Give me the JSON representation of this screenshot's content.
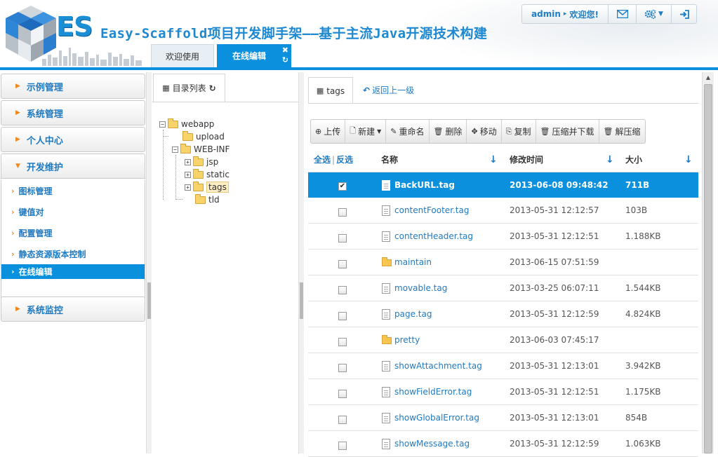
{
  "header": {
    "logo_text": "ES",
    "title": "Easy-Scaffold项目开发脚手架——基于主流Java开源技术构建",
    "user": "admin",
    "welcome": "欢迎您!",
    "tabs": [
      {
        "label": "欢迎使用"
      },
      {
        "label": "在线编辑"
      }
    ]
  },
  "sidebar": {
    "sections": [
      {
        "label": "示例管理"
      },
      {
        "label": "系统管理"
      },
      {
        "label": "个人中心"
      },
      {
        "label": "开发维护"
      },
      {
        "label": "系统监控"
      }
    ],
    "devops_items": [
      {
        "label": "图标管理"
      },
      {
        "label": "键值对"
      },
      {
        "label": "配置管理"
      },
      {
        "label": "静态资源版本控制"
      },
      {
        "label": "在线编辑"
      }
    ]
  },
  "tree": {
    "tab_label": "目录列表",
    "nodes": {
      "webapp": "webapp",
      "upload": "upload",
      "web_inf": "WEB-INF",
      "jsp": "jsp",
      "static": "static",
      "tags": "tags",
      "tld": "tld"
    }
  },
  "files": {
    "tab_label": "tags",
    "back_label": "返回上一级",
    "toolbar": [
      {
        "label": "上传",
        "icon": "upload-icon"
      },
      {
        "label": "新建",
        "icon": "new-file-icon"
      },
      {
        "label": "重命名",
        "icon": "edit-icon"
      },
      {
        "label": "删除",
        "icon": "trash-icon"
      },
      {
        "label": "移动",
        "icon": "move-icon"
      },
      {
        "label": "复制",
        "icon": "copy-icon"
      },
      {
        "label": "压缩并下载",
        "icon": "trash-icon"
      },
      {
        "label": "解压缩",
        "icon": "trash-icon"
      }
    ],
    "select_all": "全选",
    "invert": "反选",
    "columns": {
      "name": "名称",
      "mtime": "修改时间",
      "size": "大小"
    },
    "rows": [
      {
        "type": "file",
        "name": "BackURL.tag",
        "mtime": "2013-06-08 09:48:42",
        "size": "711B",
        "selected": true
      },
      {
        "type": "file",
        "name": "contentFooter.tag",
        "mtime": "2013-05-31 12:12:57",
        "size": "103B"
      },
      {
        "type": "file",
        "name": "contentHeader.tag",
        "mtime": "2013-05-31 12:12:51",
        "size": "1.188KB"
      },
      {
        "type": "folder",
        "name": "maintain",
        "mtime": "2013-06-15 07:51:59",
        "size": ""
      },
      {
        "type": "file",
        "name": "movable.tag",
        "mtime": "2013-03-25 06:07:11",
        "size": "1.544KB"
      },
      {
        "type": "file",
        "name": "page.tag",
        "mtime": "2013-05-31 12:12:59",
        "size": "4.824KB"
      },
      {
        "type": "folder",
        "name": "pretty",
        "mtime": "2013-06-03 07:45:17",
        "size": ""
      },
      {
        "type": "file",
        "name": "showAttachment.tag",
        "mtime": "2013-05-31 12:13:01",
        "size": "3.942KB"
      },
      {
        "type": "file",
        "name": "showFieldError.tag",
        "mtime": "2013-05-31 12:12:51",
        "size": "1.175KB"
      },
      {
        "type": "file",
        "name": "showGlobalError.tag",
        "mtime": "2013-05-31 12:13:01",
        "size": "854B"
      },
      {
        "type": "file",
        "name": "showMessage.tag",
        "mtime": "2013-05-31 12:12:59",
        "size": "1.063KB"
      }
    ]
  },
  "colors": {
    "accent": "#0a90dc",
    "link": "#1f7ac2",
    "caret": "#f08a20"
  }
}
